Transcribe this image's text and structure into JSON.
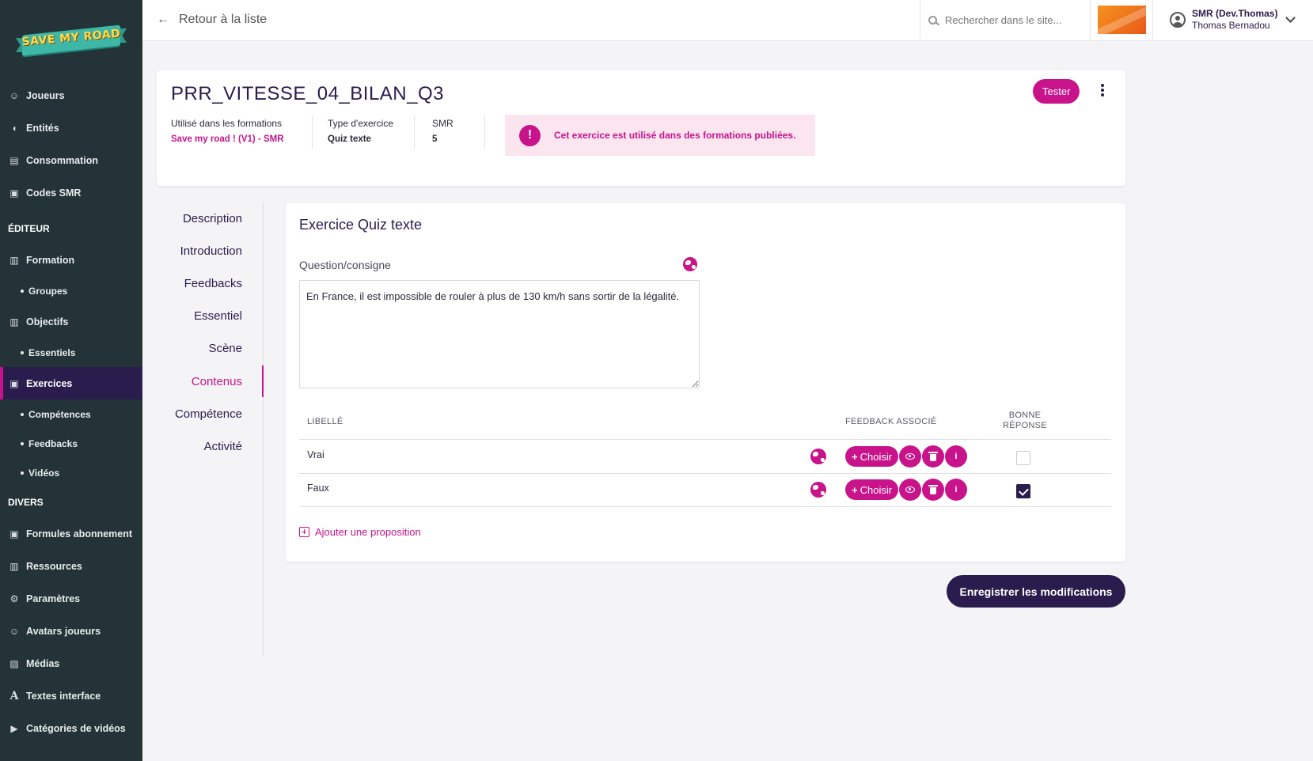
{
  "sidebar": {
    "logo_text": "SAVE MY ROAD",
    "items_top": [
      {
        "label": "Joueurs",
        "icon": "users-icon"
      },
      {
        "label": "Entités",
        "icon": "shield-icon"
      },
      {
        "label": "Consommation",
        "icon": "cart-icon"
      },
      {
        "label": "Codes SMR",
        "icon": "gift-icon"
      }
    ],
    "section_editor": "ÉDITEUR",
    "editor_items": {
      "formation": "Formation",
      "groupes": "Groupes",
      "objectifs": "Objectifs",
      "essentiels": "Essentiels",
      "exercices": "Exercices",
      "competences": "Compétences",
      "feedbacks": "Feedbacks",
      "videos": "Vidéos"
    },
    "section_divers": "DIVERS",
    "divers_items": [
      {
        "label": "Formules abonnement",
        "icon": "gift-icon"
      },
      {
        "label": "Ressources",
        "icon": "book-icon"
      },
      {
        "label": "Paramètres",
        "icon": "gears-icon"
      },
      {
        "label": "Avatars joueurs",
        "icon": "avatar-icon"
      },
      {
        "label": "Médias",
        "icon": "image-icon"
      },
      {
        "label": "Textes interface",
        "icon": "font-icon"
      },
      {
        "label": "Catégories de vidéos",
        "icon": "video-icon"
      }
    ]
  },
  "topbar": {
    "back_label": "Retour à la liste",
    "search_placeholder": "Rechercher dans le site...",
    "user_role": "SMR (Dev.Thomas)",
    "user_name": "Thomas Bernadou"
  },
  "header": {
    "title": "PRR_VITESSE_04_BILAN_Q3",
    "tester_label": "Tester",
    "used_in_label": "Utilisé dans les formations",
    "used_in_value": "Save my road ! (V1) - SMR",
    "type_label": "Type d'exercice",
    "type_value": "Quiz texte",
    "smr_label": "SMR",
    "smr_value": "5",
    "alert_text": "Cet exercice est utilisé dans des formations publiées."
  },
  "tabs": [
    "Description",
    "Introduction",
    "Feedbacks",
    "Essentiel",
    "Scène",
    "Contenus",
    "Compétence",
    "Activité"
  ],
  "active_tab": "Contenus",
  "main": {
    "heading": "Exercice Quiz texte",
    "question_label": "Question/consigne",
    "question_text": "En France, il est impossible de rouler à plus de 130 km/h sans sortir de la légalité.",
    "col_libelle": "LIBELLÉ",
    "col_feedback": "FEEDBACK ASSOCIÉ",
    "col_bonne_1": "BONNE",
    "col_bonne_2": "RÉPONSE",
    "choisir_label": "Choisir",
    "rows": [
      {
        "label": "Vrai",
        "correct": false
      },
      {
        "label": "Faux",
        "correct": true
      }
    ],
    "add_label": "Ajouter une proposition"
  },
  "save_label": "Enregistrer les modifications",
  "colors": {
    "accent": "#c8138b",
    "dark": "#2a1c4d",
    "sidebar": "#243338"
  }
}
